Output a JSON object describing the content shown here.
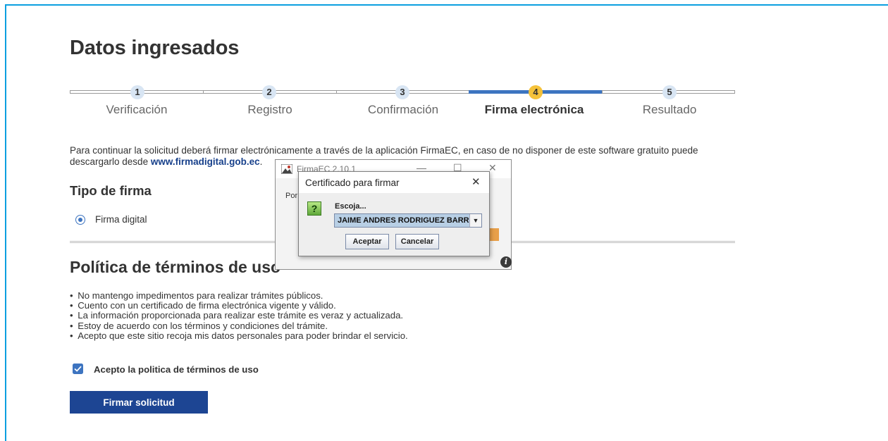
{
  "page": {
    "title": "Datos ingresados",
    "intro_text": "Para continuar la solicitud deberá firmar electrónicamente a través de la aplicación FirmaEC, en caso de no disponer de este software gratuito puede descargarlo desde ",
    "intro_link": "www.firmadigital.gob.ec",
    "intro_end": "."
  },
  "stepper": {
    "active_color": "#3d74c0",
    "active_circle_color": "#f5c23a",
    "steps": [
      {
        "number": "1",
        "label": "Verificación",
        "active": false
      },
      {
        "number": "2",
        "label": "Registro",
        "active": false
      },
      {
        "number": "3",
        "label": "Confirmación",
        "active": false
      },
      {
        "number": "4",
        "label": "Firma electrónica",
        "active": true
      },
      {
        "number": "5",
        "label": "Resultado",
        "active": false
      }
    ]
  },
  "tipo_firma": {
    "heading": "Tipo de firma",
    "option_label": "Firma digital",
    "selected": true
  },
  "politica": {
    "heading": "Política de términos de uso",
    "items": [
      "No mantengo impedimentos para realizar trámites públicos.",
      "Cuento con un certificado de firma electrónica vigente y válido.",
      "La información proporcionada para realizar este trámite es veraz y actualizada.",
      "Estoy de acuerdo con los términos y condiciones del trámite.",
      "Acepto que este sitio recoja mis datos personales para poder brindar el servicio."
    ],
    "accept_label": "Acepto la politica de términos de uso",
    "accepted": true
  },
  "submit": {
    "label": "Firmar solicitud",
    "color": "#1d4593"
  },
  "firmaec_window": {
    "title": "FirmaEC 2.10.1",
    "minimize": "—",
    "maximize": "☐",
    "close": "✕",
    "partial_text": "Por",
    "info_icon": "i"
  },
  "cert_dialog": {
    "title": "Certificado para firmar",
    "close": "✕",
    "question_icon": "?",
    "prompt": "Escoja...",
    "selected_cert": "JAIME ANDRES RODRIGUEZ BARROS",
    "accept_label": "Aceptar",
    "cancel_label": "Cancelar"
  }
}
